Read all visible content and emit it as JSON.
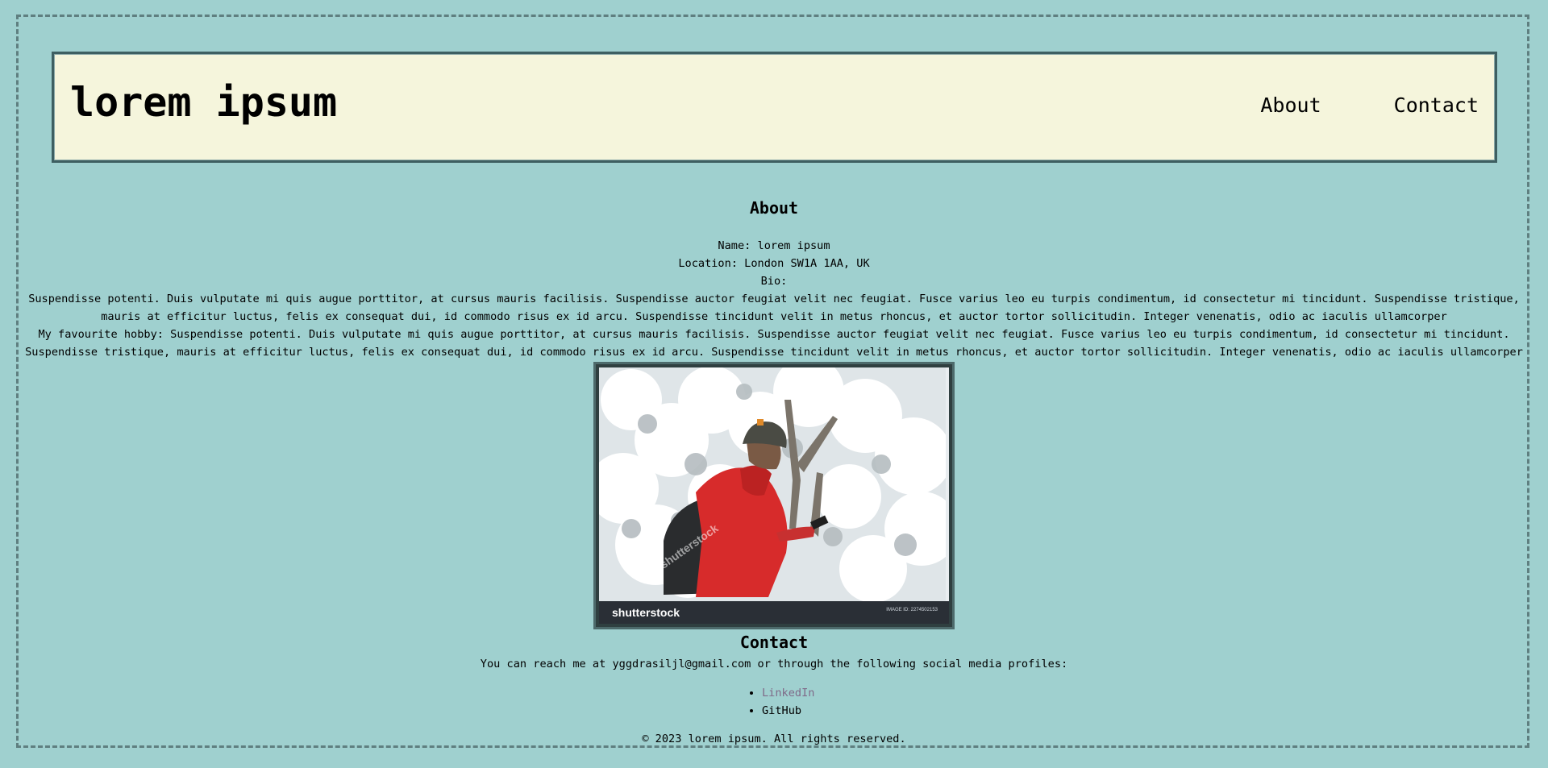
{
  "header": {
    "site_title": "lorem ipsum",
    "nav": [
      {
        "label": "About"
      },
      {
        "label": "Contact"
      }
    ]
  },
  "about": {
    "heading": "About",
    "name_line": "Name: lorem ipsum",
    "location_line": "Location: London SW1A 1AA, UK",
    "bio_label": "Bio:",
    "bio_text": "Suspendisse potenti. Duis vulputate mi quis augue porttitor, at cursus mauris facilisis. Suspendisse auctor feugiat velit nec feugiat. Fusce varius leo eu turpis condimentum, id consectetur mi tincidunt. Suspendisse tristique, mauris at efficitur luctus, felis ex consequat dui, id commodo risus ex id arcu. Suspendisse tincidunt velit in metus rhoncus, et auctor tortor sollicitudin. Integer venenatis, odio ac iaculis ullamcorper",
    "hobby_text": "My favourite hobby: Suspendisse potenti. Duis vulputate mi quis augue porttitor, at cursus mauris facilisis. Suspendisse auctor feugiat velit nec feugiat. Fusce varius leo eu turpis condimentum, id consectetur mi tincidunt. Suspendisse tristique, mauris at efficitur luctus, felis ex consequat dui, id commodo risus ex id arcu. Suspendisse tincidunt velit in metus rhoncus, et auctor tortor sollicitudin. Integer venenatis, odio ac iaculis ullamcorper"
  },
  "photo": {
    "brand": "shutterstock",
    "image_id": "IMAGE ID: 2274502153",
    "watermark_text": "shutterstock"
  },
  "contact": {
    "heading": "Contact",
    "text": "You can reach me at yggdrasiljl@gmail.com or through the following social media profiles:",
    "links": [
      {
        "label": "LinkedIn"
      },
      {
        "label": "GitHub"
      }
    ]
  },
  "footer": {
    "text": "© 2023 lorem ipsum. All rights reserved."
  },
  "colors": {
    "background": "#9fd0cf",
    "header_background": "#f5f5dc",
    "border": "#3e5f61",
    "link_visited": "#7f6a88"
  }
}
